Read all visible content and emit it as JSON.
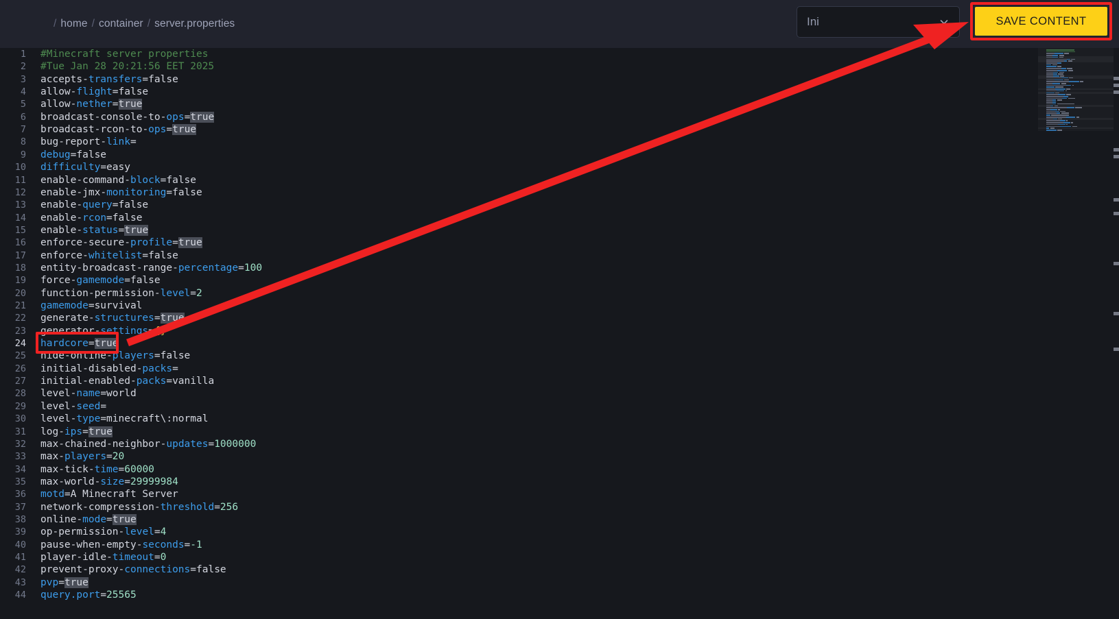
{
  "header": {
    "breadcrumb": {
      "name": "breadcrumb",
      "separator": "/",
      "items": [
        "home",
        "container",
        "server.properties"
      ]
    },
    "language_select": {
      "value": "Ini",
      "icon": "chevron-down-icon"
    },
    "save_button": {
      "label": "SAVE CONTENT",
      "color": "#fdd017",
      "highlight_color": "#ef2222"
    }
  },
  "editor": {
    "active_line": 24,
    "first_visible_line": 1,
    "last_visible_line": 44,
    "colors": {
      "background": "#16181d",
      "comment": "#4e8a50",
      "key_blue": "#3d9dec",
      "text": "#d4d7e0",
      "number": "#9fe0c7",
      "brace": "#e8c547",
      "match_highlight": "#4a4e58"
    },
    "search_term": "true",
    "lines": [
      {
        "n": 1,
        "comment": "#Minecraft server properties"
      },
      {
        "n": 2,
        "comment": "#Tue Jan 28 20:21:56 EET 2025"
      },
      {
        "n": 3,
        "key": "accepts-transfers",
        "value": "false"
      },
      {
        "n": 4,
        "key": "allow-flight",
        "value": "false"
      },
      {
        "n": 5,
        "key": "allow-nether",
        "value": "true",
        "hl": true
      },
      {
        "n": 6,
        "key": "broadcast-console-to-ops",
        "value": "true",
        "hl": true
      },
      {
        "n": 7,
        "key": "broadcast-rcon-to-ops",
        "value": "true",
        "hl": true
      },
      {
        "n": 8,
        "key": "bug-report-link",
        "value": ""
      },
      {
        "n": 9,
        "key": "debug",
        "value": "false"
      },
      {
        "n": 10,
        "key": "difficulty",
        "value": "easy"
      },
      {
        "n": 11,
        "key": "enable-command-block",
        "value": "false"
      },
      {
        "n": 12,
        "key": "enable-jmx-monitoring",
        "value": "false"
      },
      {
        "n": 13,
        "key": "enable-query",
        "value": "false"
      },
      {
        "n": 14,
        "key": "enable-rcon",
        "value": "false"
      },
      {
        "n": 15,
        "key": "enable-status",
        "value": "true",
        "hl": true
      },
      {
        "n": 16,
        "key": "enforce-secure-profile",
        "value": "true",
        "hl": true
      },
      {
        "n": 17,
        "key": "enforce-whitelist",
        "value": "false"
      },
      {
        "n": 18,
        "key": "entity-broadcast-range-percentage",
        "value": "100",
        "num": true
      },
      {
        "n": 19,
        "key": "force-gamemode",
        "value": "false"
      },
      {
        "n": 20,
        "key": "function-permission-level",
        "value": "2",
        "num": true
      },
      {
        "n": 21,
        "key": "gamemode",
        "value": "survival"
      },
      {
        "n": 22,
        "key": "generate-structures",
        "value": "true",
        "hl": true
      },
      {
        "n": 23,
        "key": "generator-settings",
        "value": "{}",
        "brace": true
      },
      {
        "n": 24,
        "key": "hardcore",
        "value": "true",
        "hl": true,
        "active": true
      },
      {
        "n": 25,
        "key": "hide-online-players",
        "value": "false"
      },
      {
        "n": 26,
        "key": "initial-disabled-packs",
        "value": ""
      },
      {
        "n": 27,
        "key": "initial-enabled-packs",
        "value": "vanilla"
      },
      {
        "n": 28,
        "key": "level-name",
        "value": "world"
      },
      {
        "n": 29,
        "key": "level-seed",
        "value": ""
      },
      {
        "n": 30,
        "key": "level-type",
        "value": "minecraft\\:normal"
      },
      {
        "n": 31,
        "key": "log-ips",
        "value": "true",
        "hl": true
      },
      {
        "n": 32,
        "key": "max-chained-neighbor-updates",
        "value": "1000000",
        "num": true
      },
      {
        "n": 33,
        "key": "max-players",
        "value": "20",
        "num": true
      },
      {
        "n": 34,
        "key": "max-tick-time",
        "value": "60000",
        "num": true
      },
      {
        "n": 35,
        "key": "max-world-size",
        "value": "29999984",
        "num": true
      },
      {
        "n": 36,
        "key": "motd",
        "value": "A Minecraft Server"
      },
      {
        "n": 37,
        "key": "network-compression-threshold",
        "value": "256",
        "num": true
      },
      {
        "n": 38,
        "key": "online-mode",
        "value": "true",
        "hl": true
      },
      {
        "n": 39,
        "key": "op-permission-level",
        "value": "4",
        "num": true
      },
      {
        "n": 40,
        "key": "pause-when-empty-seconds",
        "value": "-1",
        "num": true
      },
      {
        "n": 41,
        "key": "player-idle-timeout",
        "value": "0",
        "num": true
      },
      {
        "n": 42,
        "key": "prevent-proxy-connections",
        "value": "false"
      },
      {
        "n": 43,
        "key": "pvp",
        "value": "true",
        "hl": true
      },
      {
        "n": 44,
        "key": "query.port",
        "value": "25565",
        "num": true
      }
    ]
  },
  "minimap": {
    "name": "minimap",
    "visible": true
  },
  "scrollbar": {
    "name": "vertical-scrollbar",
    "match_marks": 14
  },
  "annotations": {
    "highlight_box": {
      "target_line": 24,
      "color": "#ef2222"
    },
    "arrow": {
      "from": "line-24-box",
      "to": "save-content-button",
      "color": "#ef2222"
    }
  }
}
